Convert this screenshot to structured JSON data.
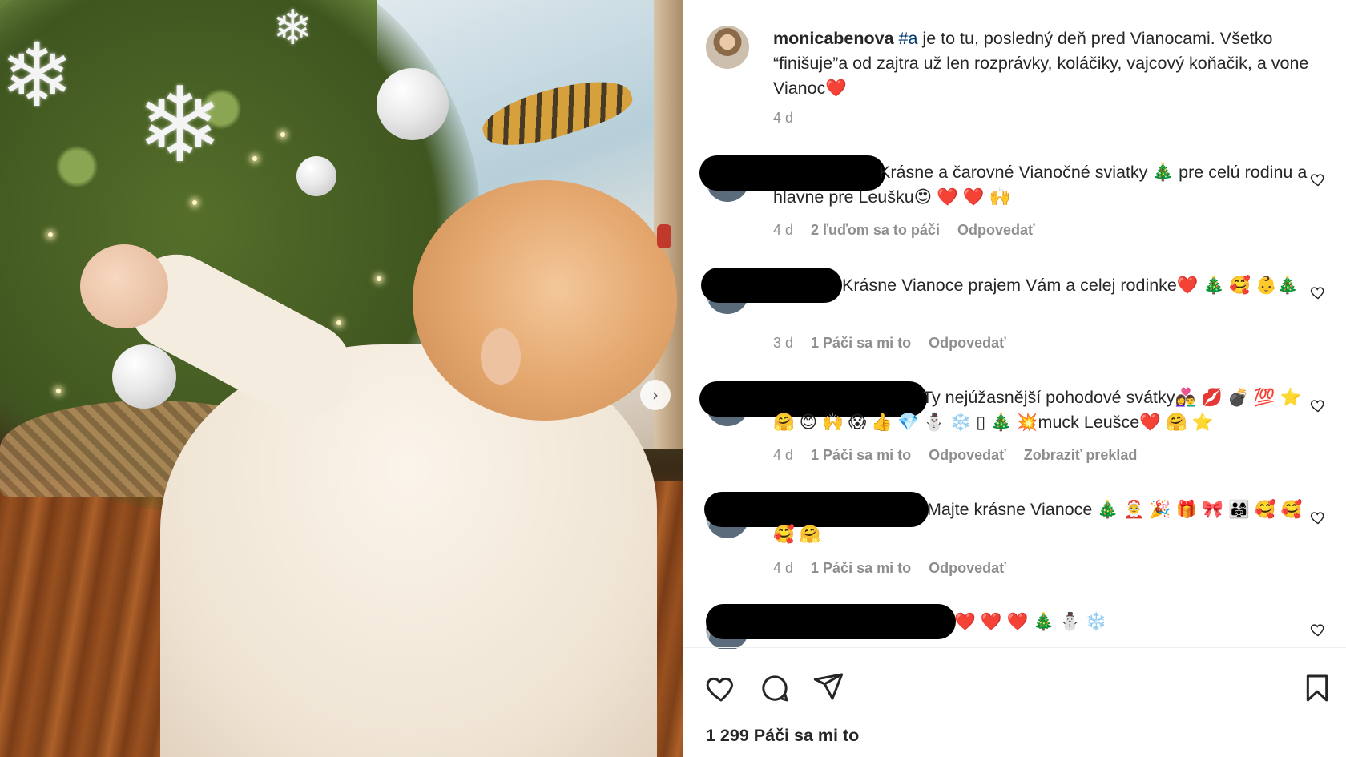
{
  "post": {
    "username": "monicabenova",
    "hashtag": "#a",
    "caption": " je to tu, posledný deň pred Vianocami. Všetko “finišuje”a od zajtra už len rozprávky, koláčiky, vajcový koňačik, a vone Vianoc❤️",
    "age": "4 d"
  },
  "comments": [
    {
      "text": "Krásne a čarovné Vianočné sviatky 🎄 pre celú rodinu a hlavne pre Leušku😍 ❤️ ❤️ 🙌",
      "age": "4 d",
      "likes": "2 ľuďom sa to páči",
      "reply": "Odpovedať",
      "translate": ""
    },
    {
      "text": "Krásne Vianoce prajem Vám a celej rodinke❤️ 🎄 🥰 👶🎄",
      "age": "3 d",
      "likes": "1 Páči sa mi to",
      "reply": "Odpovedať",
      "translate": ""
    },
    {
      "text": "Ty nejúžasnější pohodové svátky👩‍❤️‍👨 💋 💣 💯 ⭐ 🤗 😊 🙌 😱 👍 💎 ⛄ ❄️ ▯ 🎄 💥muck Leušce❤️ 🤗 ⭐",
      "age": "4 d",
      "likes": "1 Páči sa mi to",
      "reply": "Odpovedať",
      "translate": "Zobraziť preklad"
    },
    {
      "text": "Majte krásne Vianoce 🎄 🤶 🎉 🎁 🎀 👨‍👩‍👧 🥰 🥰 🥰 🤗",
      "age": "4 d",
      "likes": "1 Páči sa mi to",
      "reply": "Odpovedať",
      "translate": ""
    },
    {
      "text": "❤️ ❤️ ❤️ 🎄 ⛄ ❄️",
      "age": "",
      "likes": "",
      "reply": "",
      "translate": ""
    }
  ],
  "actions": {
    "like_icon": "heart-icon",
    "comment_icon": "comment-icon",
    "share_icon": "paper-plane-icon",
    "save_icon": "bookmark-icon"
  },
  "likes_count": "1 299",
  "likes_label": " Páči sa mi to",
  "colors": {
    "text": "#262626",
    "muted": "#8e8e8e",
    "hashtag": "#00376b",
    "border": "#dbdbdb"
  }
}
